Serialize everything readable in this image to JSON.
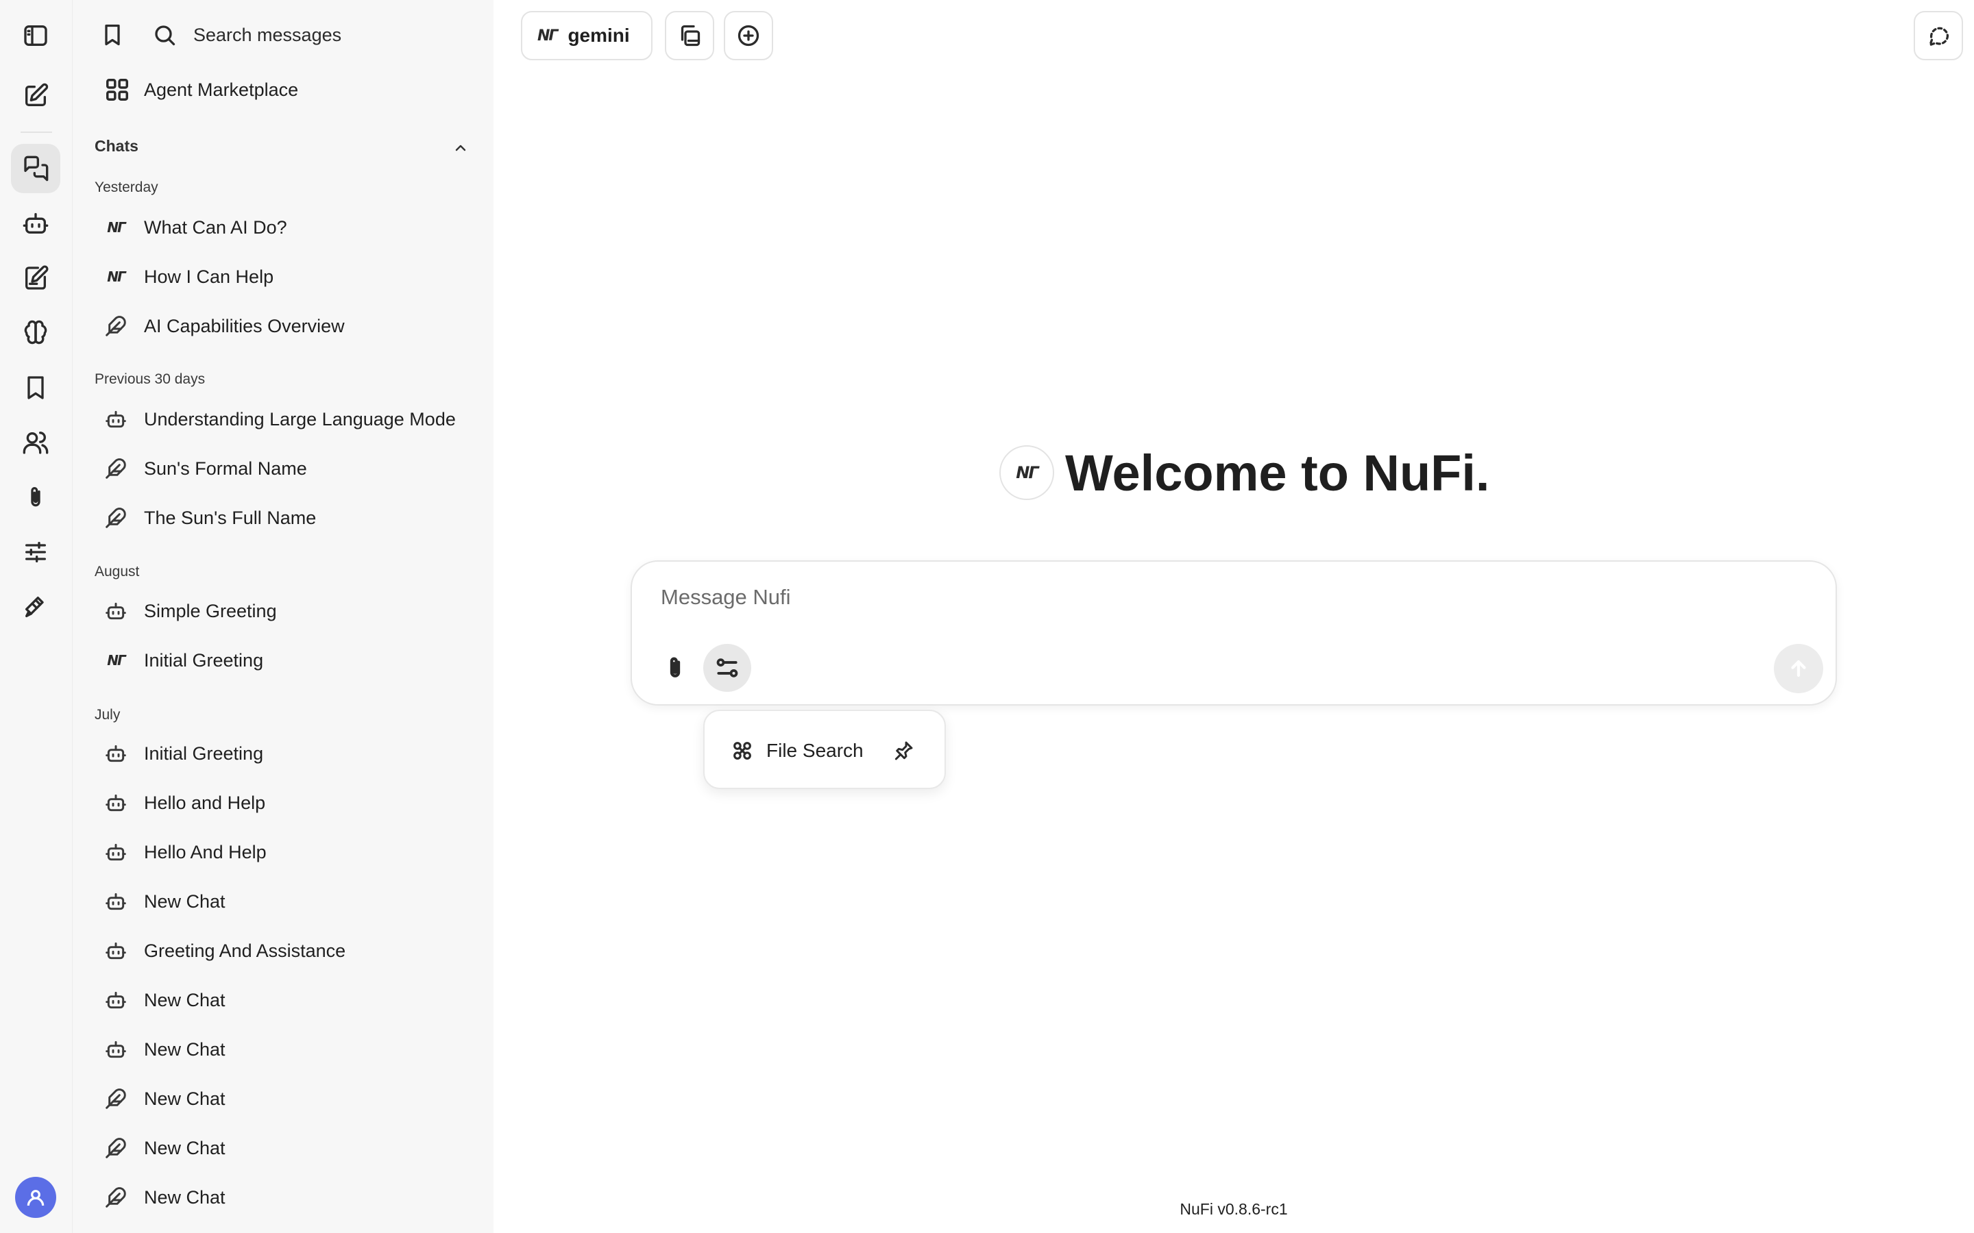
{
  "app": {
    "name": "NuFi",
    "version": "NuFi v0.8.6-rc1"
  },
  "rail": {
    "icons": [
      "sidebar-toggle-icon",
      "new-chat-icon",
      "chats-icon",
      "agents-icon",
      "prompts-icon",
      "memory-icon",
      "bookmarks-icon",
      "users-icon",
      "attachments-icon",
      "settings-sliders-icon",
      "plugins-icon",
      "user-avatar-icon"
    ],
    "active": "chats-icon"
  },
  "sidebar": {
    "search_label": "Search messages",
    "marketplace_label": "Agent Marketplace",
    "chats_title": "Chats",
    "groups": [
      {
        "label": "Yesterday",
        "items": [
          {
            "label": "What Can AI Do?",
            "icon": "nufi-logo-icon"
          },
          {
            "label": "How I Can Help",
            "icon": "nufi-logo-icon"
          },
          {
            "label": "AI Capabilities Overview",
            "icon": "feather-icon"
          }
        ]
      },
      {
        "label": "Previous 30 days",
        "items": [
          {
            "label": "Understanding Large Language Mode",
            "icon": "bot-icon"
          },
          {
            "label": "Sun's Formal Name",
            "icon": "feather-icon"
          },
          {
            "label": "The Sun's Full Name",
            "icon": "feather-icon"
          }
        ]
      },
      {
        "label": "August",
        "items": [
          {
            "label": "Simple Greeting",
            "icon": "bot-icon"
          },
          {
            "label": "Initial Greeting",
            "icon": "nufi-logo-icon"
          }
        ]
      },
      {
        "label": "July",
        "items": [
          {
            "label": "Initial Greeting",
            "icon": "bot-icon"
          },
          {
            "label": "Hello and Help",
            "icon": "bot-icon"
          },
          {
            "label": "Hello And Help",
            "icon": "bot-icon"
          },
          {
            "label": "New Chat",
            "icon": "bot-icon"
          },
          {
            "label": "Greeting And Assistance",
            "icon": "bot-icon"
          },
          {
            "label": "New Chat",
            "icon": "bot-icon"
          },
          {
            "label": "New Chat",
            "icon": "bot-icon"
          },
          {
            "label": "New Chat",
            "icon": "feather-icon"
          },
          {
            "label": "New Chat",
            "icon": "feather-icon"
          },
          {
            "label": "New Chat",
            "icon": "feather-icon"
          }
        ]
      }
    ]
  },
  "topbar": {
    "model_logo": "NΓ",
    "model_label": "gemini"
  },
  "main": {
    "welcome_logo": "NΓ",
    "welcome_title": "Welcome to NuFi.",
    "composer_placeholder": "Message Nufi",
    "popover": {
      "item_label": "File Search"
    }
  },
  "colors": {
    "accent": "#5b6ee6",
    "sidebar_bg": "#f7f7f7"
  }
}
